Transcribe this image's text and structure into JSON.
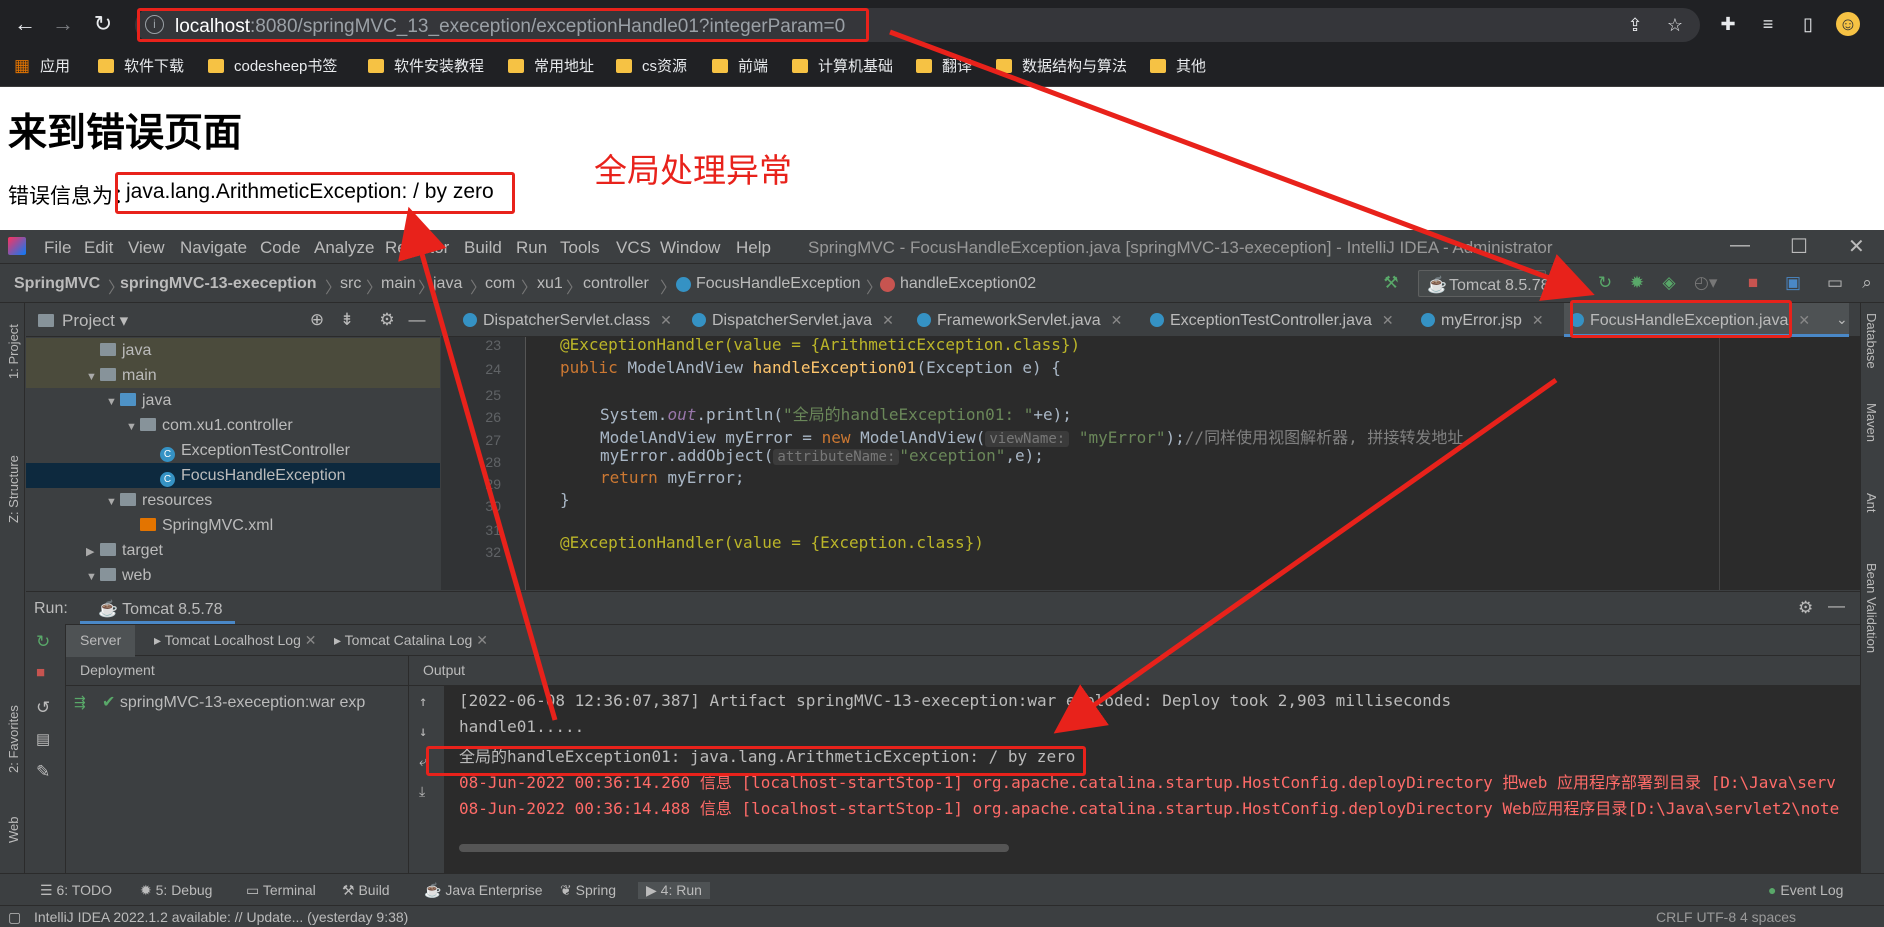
{
  "browser": {
    "url_host": "localhost",
    "url_rest": ":8080/springMVC_13_exeception/exceptionHandle01?integerParam=0",
    "bookmarks": [
      "应用",
      "软件下载",
      "codesheep书签",
      "软件安装教程",
      "常用地址",
      "cs资源",
      "前端",
      "计算机基础",
      "翻译",
      "数据结构与算法",
      "其他"
    ]
  },
  "page": {
    "heading": "来到错误页面",
    "error_label": "错误信息为：",
    "error_message": "java.lang.ArithmeticException: / by zero",
    "annotation": "全局处理异常"
  },
  "ide": {
    "menu": [
      "File",
      "Edit",
      "View",
      "Navigate",
      "Code",
      "Analyze",
      "Refactor",
      "Build",
      "Run",
      "Tools",
      "VCS",
      "Window",
      "Help"
    ],
    "title": "SpringMVC - FocusHandleException.java [springMVC-13-exeception] - IntelliJ IDEA - Administrator",
    "breadcrumb": [
      "SpringMVC",
      "springMVC-13-exeception",
      "src",
      "main",
      "java",
      "com",
      "xu1",
      "controller",
      "FocusHandleException",
      "handleException02"
    ],
    "run_config": "Tomcat 8.5.78",
    "project_label": "Project",
    "tree": [
      {
        "label": "java",
        "indent": 1,
        "kind": "folder",
        "state": "dim"
      },
      {
        "label": "main",
        "indent": 1,
        "kind": "folder",
        "arrow": "▼",
        "state": "dim"
      },
      {
        "label": "java",
        "indent": 2,
        "kind": "folder-blue",
        "arrow": "▼"
      },
      {
        "label": "com.xu1.controller",
        "indent": 3,
        "kind": "folder",
        "arrow": "▼"
      },
      {
        "label": "ExceptionTestController",
        "indent": 4,
        "kind": "class"
      },
      {
        "label": "FocusHandleException",
        "indent": 4,
        "kind": "class",
        "state": "sel"
      },
      {
        "label": "resources",
        "indent": 2,
        "kind": "folder",
        "arrow": "▼"
      },
      {
        "label": "SpringMVC.xml",
        "indent": 3,
        "kind": "xml"
      },
      {
        "label": "target",
        "indent": 1,
        "kind": "folder",
        "arrow": "▶"
      },
      {
        "label": "web",
        "indent": 1,
        "kind": "folder",
        "arrow": "▼"
      }
    ],
    "tabs": [
      "DispatcherServlet.class",
      "DispatcherServlet.java",
      "FrameworkServlet.java",
      "ExceptionTestController.java",
      "myError.jsp",
      "FocusHandleException.java"
    ],
    "line_numbers": [
      "23",
      "24",
      "25",
      "26",
      "27",
      "28",
      "29",
      "30",
      "31",
      "32"
    ],
    "code": {
      "l23": "@ExceptionHandler(value = {ArithmeticException.class})",
      "l24a": "public ",
      "l24b": "ModelAndView ",
      "l24c": "handleException01",
      "l24d": "(Exception e) {",
      "l26a": "System.",
      "l26b": "out",
      "l26c": ".println(",
      "l26d": "\"全局的handleException01: \"",
      "l26e": "+e);",
      "l27a": "ModelAndView myError = ",
      "l27b": "new ",
      "l27c": "ModelAndView(",
      "l27hint": "viewName:",
      "l27d": "\"myError\"",
      "l27e": ");",
      "l27f": "//同样使用视图解析器, 拼接转发地址",
      "l28a": "myError.addObject(",
      "l28hint": "attributeName:",
      "l28b": "\"exception\"",
      "l28c": ",e);",
      "l29a": "return ",
      "l29b": "myError;",
      "l30": "}",
      "l32": "@ExceptionHandler(value = {Exception.class})"
    },
    "run": {
      "label": "Run:",
      "config_tab": "Tomcat 8.5.78",
      "subtabs": [
        "Server",
        "Tomcat Localhost Log",
        "Tomcat Catalina Log"
      ],
      "deployment": "Deployment",
      "output": "Output",
      "artifact": "springMVC-13-exeception:war exp",
      "lines": [
        "[2022-06-08 12:36:07,387] Artifact springMVC-13-exeception:war exploded: Deploy took 2,903 milliseconds",
        "handle01.....",
        "全局的handleException01: java.lang.ArithmeticException: / by zero",
        "08-Jun-2022 00:36:14.260 信息 [localhost-startStop-1] org.apache.catalina.startup.HostConfig.deployDirectory 把web 应用程序部署到目录 [D:\\Java\\serv",
        "08-Jun-2022 00:36:14.488 信息 [localhost-startStop-1] org.apache.catalina.startup.HostConfig.deployDirectory Web应用程序目录[D:\\Java\\servlet2\\note"
      ]
    },
    "bottom_tools": [
      "6: TODO",
      "5: Debug",
      "Terminal",
      "Build",
      "Java Enterprise",
      "Spring",
      "4: Run",
      "Event Log"
    ],
    "status": "IntelliJ IDEA 2022.1.2 available: // Update... (yesterday 9:38)",
    "status_right": "CRLF   UTF-8   4 spaces",
    "left_labels": [
      "1: Project",
      "Z: Structure",
      "2: Favorites",
      "Web"
    ],
    "right_labels": [
      "Database",
      "Maven",
      "Ant",
      "Bean Validation"
    ]
  },
  "colors": {
    "annotation_red": "#e8221b",
    "accent": "#4a88c7"
  }
}
